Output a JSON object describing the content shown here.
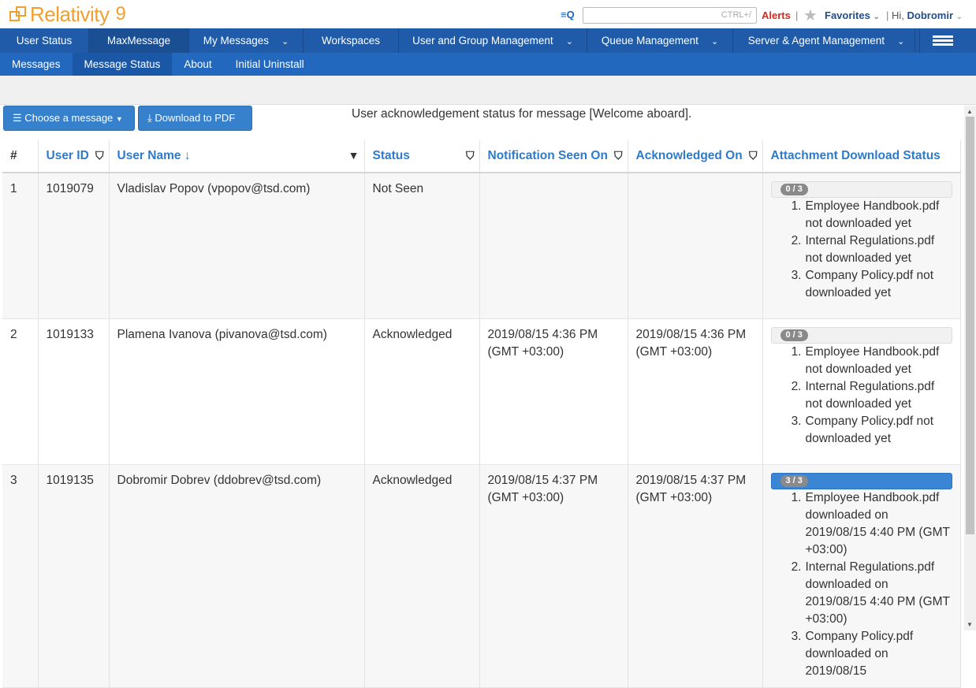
{
  "header": {
    "logo_text": "Relativity",
    "logo_version": "9",
    "search_placeholder": "CTRL+/",
    "alerts": "Alerts",
    "favorites": "Favorites",
    "greeting": "Hi,",
    "user": "Dobromir"
  },
  "main_nav": [
    {
      "label": "User Status"
    },
    {
      "label": "MaxMessage"
    },
    {
      "label": "My Messages"
    },
    {
      "label": "Workspaces"
    },
    {
      "label": "User and Group Management"
    },
    {
      "label": "Queue Management"
    },
    {
      "label": "Server & Agent Management"
    }
  ],
  "sub_nav": [
    {
      "label": "Messages"
    },
    {
      "label": "Message Status"
    },
    {
      "label": "About"
    },
    {
      "label": "Initial Uninstall"
    }
  ],
  "toolbar": {
    "choose_label": "Choose a message",
    "pdf_label": "Download to PDF",
    "caption": "User acknowledgement status for message [Welcome aboard]."
  },
  "table": {
    "headers": [
      "#",
      "User ID",
      "User Name ↓",
      "Status",
      "Notification Seen On",
      "Acknowledged On",
      "Attachment Download Status"
    ],
    "rows": [
      {
        "num": "1",
        "user_id": "1019079",
        "user_name": "Vladislav Popov (vpopov@tsd.com)",
        "status": "Not Seen",
        "seen_on": "",
        "ack_on": "",
        "progress": "0 / 3",
        "progress_fraction": 0,
        "attachments": [
          "Employee Handbook.pdf not downloaded yet",
          "Internal Regulations.pdf not downloaded yet",
          "Company Policy.pdf not downloaded yet"
        ]
      },
      {
        "num": "2",
        "user_id": "1019133",
        "user_name": "Plamena Ivanova (pivanova@tsd.com)",
        "status": "Acknowledged",
        "seen_on": "2019/08/15 4:36 PM (GMT +03:00)",
        "ack_on": "2019/08/15 4:36 PM (GMT +03:00)",
        "progress": "0 / 3",
        "progress_fraction": 0,
        "attachments": [
          "Employee Handbook.pdf not downloaded yet",
          "Internal Regulations.pdf not downloaded yet",
          "Company Policy.pdf not downloaded yet"
        ]
      },
      {
        "num": "3",
        "user_id": "1019135",
        "user_name": "Dobromir Dobrev (ddobrev@tsd.com)",
        "status": "Acknowledged",
        "seen_on": "2019/08/15 4:37 PM (GMT +03:00)",
        "ack_on": "2019/08/15 4:37 PM (GMT +03:00)",
        "progress": "3 / 3",
        "progress_fraction": 1,
        "attachments": [
          "Employee Handbook.pdf downloaded on 2019/08/15 4:40 PM (GMT +03:00)",
          "Internal Regulations.pdf downloaded on 2019/08/15 4:40 PM (GMT +03:00)",
          "Company Policy.pdf downloaded on 2019/08/15"
        ]
      }
    ]
  },
  "colors": {
    "brand_orange": "#f0a031",
    "nav_blue": "#1f5ba8",
    "link_blue": "#2f7bc9",
    "alert_red": "#d9261c"
  }
}
